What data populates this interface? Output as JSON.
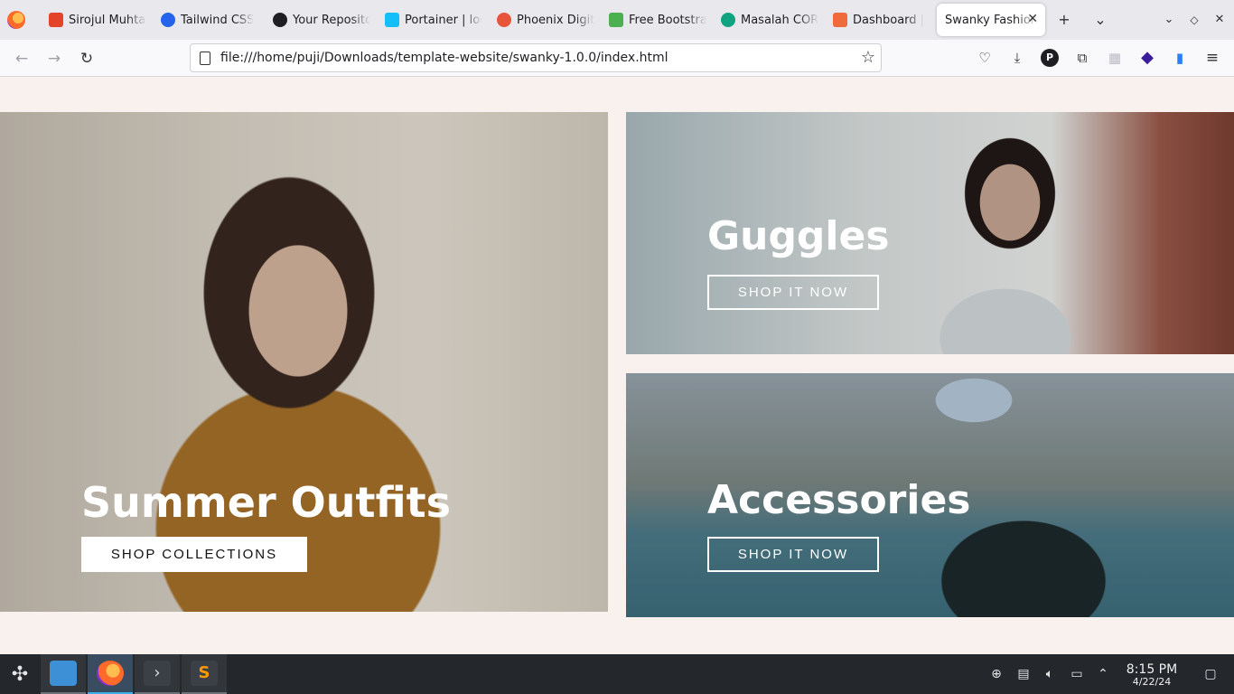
{
  "browser": {
    "tabs": [
      {
        "title": "Sirojul Muhtar",
        "color": "#e24329"
      },
      {
        "title": "Tailwind CSS",
        "color": "#2563eb"
      },
      {
        "title": "Your Repositories",
        "color": "#1f1f23"
      },
      {
        "title": "Portainer | local",
        "color": "#13bef9"
      },
      {
        "title": "Phoenix Digital",
        "color": "#e7553b"
      },
      {
        "title": "Free Bootstrap",
        "color": "#4caf50"
      },
      {
        "title": "Masalah CORS",
        "color": "#10a37f"
      },
      {
        "title": "Dashboard | ",
        "color": "#f06b3b"
      },
      {
        "title": "Swanky Fashion",
        "color": "#ffffff"
      }
    ],
    "url": "file:///home/puji/Downloads/template-website/swanky-1.0.0/index.html"
  },
  "hero": {
    "main": {
      "title": "Summer Outfits",
      "button": "SHOP COLLECTIONS"
    },
    "top_right": {
      "title": "Guggles",
      "button": "SHOP IT NOW"
    },
    "bottom_right": {
      "title": "Accessories",
      "button": "SHOP IT NOW"
    }
  },
  "taskbar": {
    "time": "8:15 PM",
    "date": "4/22/24"
  }
}
